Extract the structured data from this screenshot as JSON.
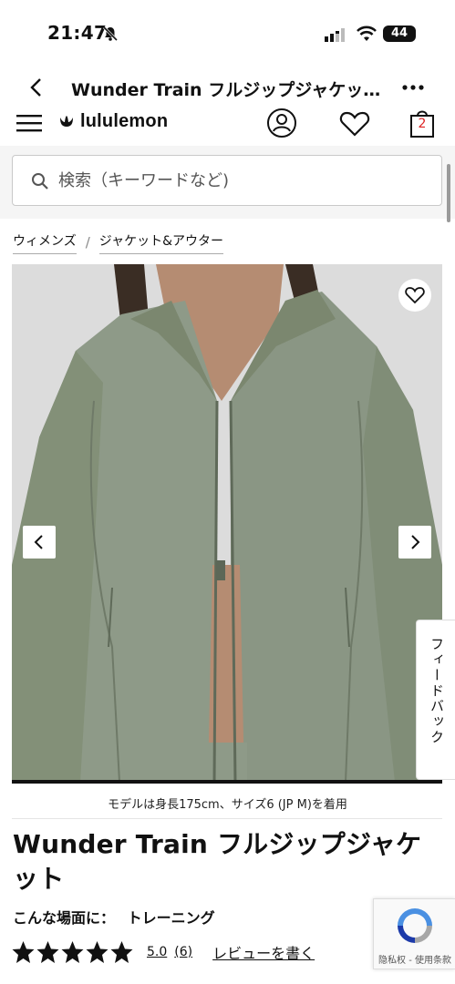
{
  "status_bar": {
    "time": "21:47",
    "battery": "44"
  },
  "browser": {
    "title": "Wunder Train フルジップジャケッ..."
  },
  "header": {
    "brand": "lululemon",
    "bag_count": "2"
  },
  "search": {
    "placeholder": "検索（キーワードなど)"
  },
  "breadcrumb": {
    "items": [
      "ウィメンズ",
      "ジャケット&アウター"
    ],
    "separator": "/"
  },
  "gallery": {
    "feedback_label": "フィードバック"
  },
  "product": {
    "model_caption": "モデルは身長175cm、サイズ6 (JP M)を着用",
    "name": "Wunder Train フルジップジャケット",
    "activity_label": "こんな場面に：",
    "activity_value": "トレーニング",
    "rating_value": "5.0",
    "rating_count": "(6)",
    "stars": 5,
    "write_review": "レビューを書く"
  },
  "recaptcha": {
    "text": "隐私权 - 使用条款"
  },
  "colors": {
    "jacket": "#8e9a88",
    "background": "#dcdcdc",
    "accent": "#d22222"
  }
}
